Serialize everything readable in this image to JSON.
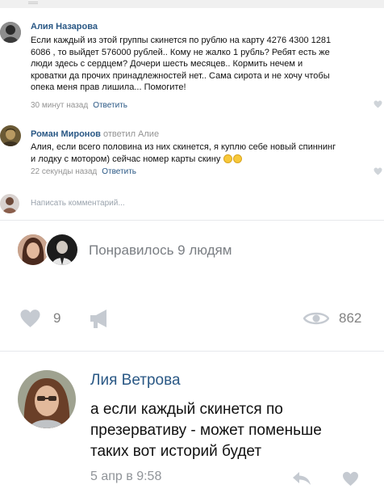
{
  "comments": [
    {
      "author": "Алия Назарова",
      "lines": [
        "Если каждый из этой группы скинется по рублю на карту 4276 4300 1281",
        "6086 , то выйдет 576000 рублей.. Кому не жалко 1 рубль? Ребят есть же",
        "люди здесь с сердцем? Дочери шесть месяцев.. Кормить нечем и",
        "кроватки да прочих принадлежностей нет.. Сама сирота и не хочу чтобы",
        "опека меня прав лишила... Помогите!"
      ],
      "time": "30 минут назад",
      "reply": "Ответить"
    },
    {
      "author": "Роман Миронов",
      "reply_to": "ответил Алие",
      "lines": [
        "Алия, если всего половина из них скинется, я куплю себе новый спиннинг",
        "и лодку с мотором) сейчас номер карты скину"
      ],
      "time": "22 секунды назад",
      "reply": "Ответить"
    }
  ],
  "reply_placeholder": "Написать комментарий...",
  "likes_text": "Понравилось 9 людям",
  "likes_count": "9",
  "views_count": "862",
  "bottom_comment": {
    "author": "Лия Ветрова",
    "lines": [
      "а если каждый скинется по",
      "презервативу - может поменьше",
      "таких вот историй будет"
    ],
    "time": "5 апр в 9:58"
  },
  "colors": {
    "link": "#2a5885",
    "muted": "#939393",
    "icon": "#c5cad1"
  }
}
